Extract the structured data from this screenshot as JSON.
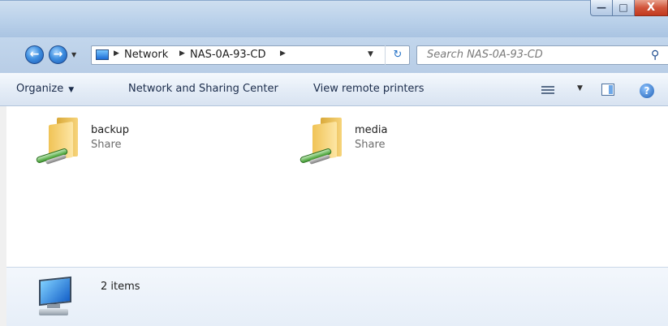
{
  "window": {
    "controls": {
      "minimize": "—",
      "maximize": "□",
      "close": "X"
    }
  },
  "nav": {
    "back_glyph": "←",
    "forward_glyph": "→",
    "breadcrumb": [
      "Network",
      "NAS-0A-93-CD"
    ],
    "search_placeholder": "Search NAS-0A-93-CD"
  },
  "toolbar": {
    "organize": "Organize",
    "network_center": "Network and Sharing Center",
    "remote_printers": "View remote printers",
    "help": "?"
  },
  "items": [
    {
      "name": "backup",
      "type": "Share"
    },
    {
      "name": "media",
      "type": "Share"
    }
  ],
  "status": {
    "count": "2 items"
  },
  "icons": [
    "back-arrow-icon",
    "forward-arrow-icon",
    "computer-icon",
    "refresh-icon",
    "search-icon",
    "view-options-icon",
    "preview-pane-icon",
    "help-icon",
    "network-folder-icon",
    "computer-monitor-icon"
  ]
}
